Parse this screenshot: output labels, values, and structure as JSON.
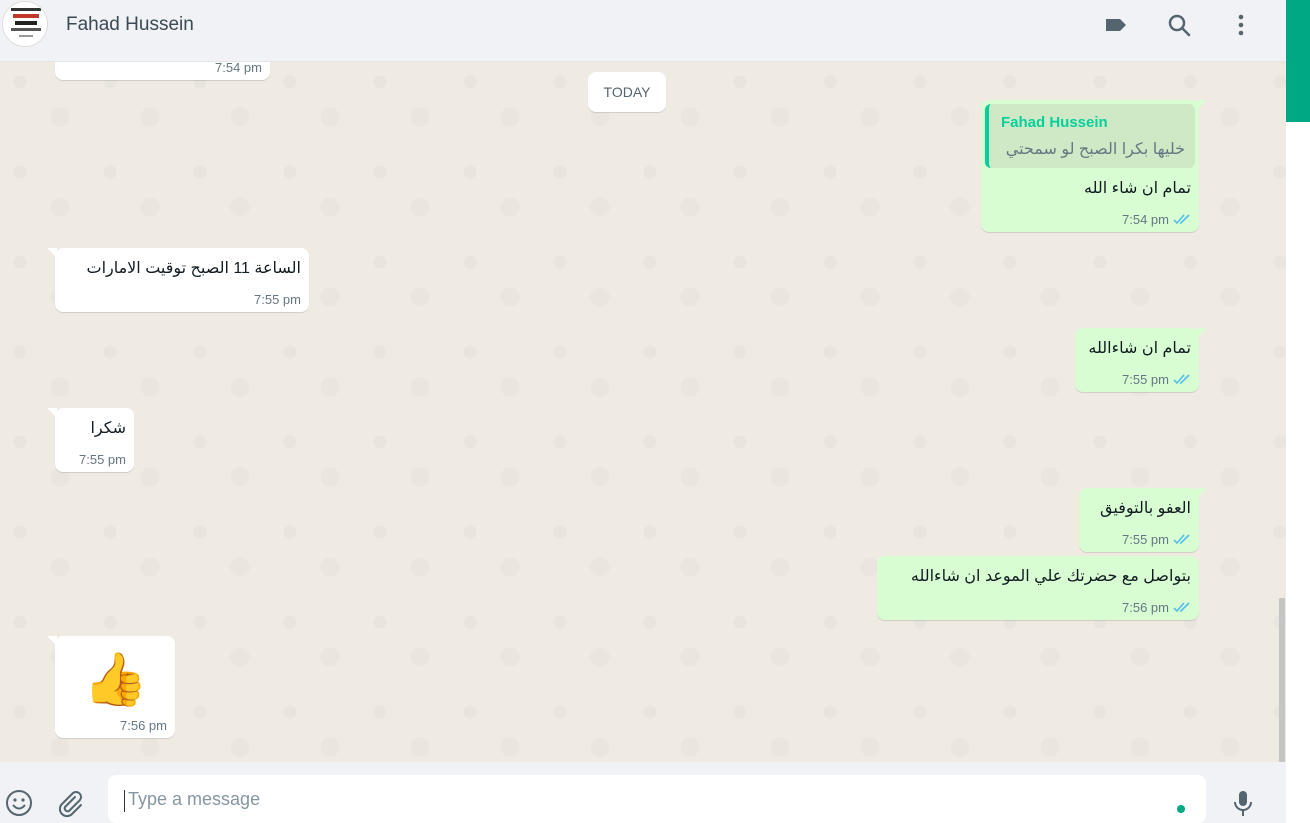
{
  "header": {
    "contact_name": "Fahad Hussein",
    "icons": [
      "label-icon",
      "search-icon",
      "more-menu-icon"
    ]
  },
  "chat": {
    "prev_time": "7:54 pm",
    "day_label": "TODAY",
    "messages": [
      {
        "dir": "out",
        "quote_name": "Fahad Hussein",
        "quote_text": "خليها بكرا الصبح لو سمحتي",
        "text": "تمام ان شاء الله",
        "time": "7:54 pm",
        "status": "read"
      },
      {
        "dir": "in",
        "text": "الساعة 11 الصبح توقيت الامارات",
        "time": "7:55 pm"
      },
      {
        "dir": "out",
        "text": "تمام ان شاءالله",
        "time": "7:55 pm",
        "status": "read"
      },
      {
        "dir": "in",
        "text": "شكرا",
        "time": "7:55 pm"
      },
      {
        "dir": "out",
        "text": "العفو بالتوفيق",
        "time": "7:55 pm",
        "status": "read"
      },
      {
        "dir": "out",
        "text": "بتواصل مع حضرتك علي الموعد ان شاءالله",
        "time": "7:56 pm",
        "status": "read"
      },
      {
        "dir": "in",
        "text": "👍",
        "time": "7:56 pm"
      }
    ]
  },
  "footer": {
    "placeholder": "Type a message",
    "icons": [
      "emoji-icon",
      "attach-icon",
      "microphone-icon"
    ]
  },
  "colors": {
    "accent": "#00a884",
    "outgoing_bubble": "#d9fdd3",
    "incoming_bubble": "#ffffff",
    "read_ticks": "#53bdeb"
  }
}
